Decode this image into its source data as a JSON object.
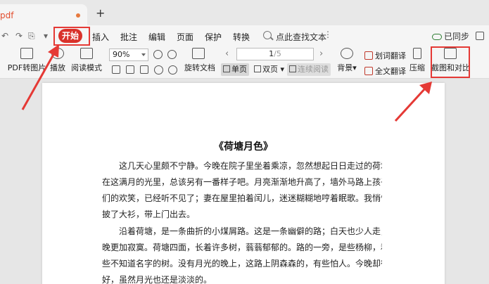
{
  "tab": {
    "title": "pdf",
    "add_label": "+"
  },
  "menubar": {
    "start_label": "开始",
    "items": [
      "插入",
      "批注",
      "编辑",
      "页面",
      "保护",
      "转换"
    ],
    "search_text": "点此查找文本",
    "more": "⋮",
    "sync_label": "已同步"
  },
  "ribbon": {
    "pdf_to_image": "PDF转图片",
    "play": "播放",
    "read_mode": "阅读模式",
    "zoom_value": "90%",
    "rotate_doc": "旋转文档",
    "page_current": "1",
    "page_total": "/5",
    "single_page": "单页",
    "double_page": "双页",
    "continuous": "连续阅读",
    "background": "背景",
    "word_translate": "划词翻译",
    "full_translate": "全文翻译",
    "compress": "压缩",
    "screenshot_compare": "截图和对比"
  },
  "document": {
    "title": "《荷塘月色》",
    "paragraph1": [
      "　　这几天心里颇不宁静。今晚在院子里坐着乘凉，忽然想起日日走过的荷塘，",
      "在这满月的光里，总该另有一番样子吧。月亮渐渐地升高了，墙外马路上孩子",
      "们的欢笑，已经听不见了；妻在屋里拍着闰儿，迷迷糊糊地哼着眠歌。我悄悄地",
      "披了大衫，带上门出去。"
    ],
    "paragraph2": [
      "　　沿着荷塘，是一条曲折的小煤屑路。这是一条幽僻的路；白天也少人走，夜",
      "晚更加寂寞。荷塘四面，长着许多树，蓊蓊郁郁的。路的一旁，是些杨柳，和　一",
      "些不知道名字的树。没有月光的晚上，这路上阴森森的，有些怕人。今晚却很",
      "好，虽然月光也还是淡淡的。"
    ]
  },
  "colors": {
    "accent": "#d9312a",
    "highlight": "#e53935"
  }
}
